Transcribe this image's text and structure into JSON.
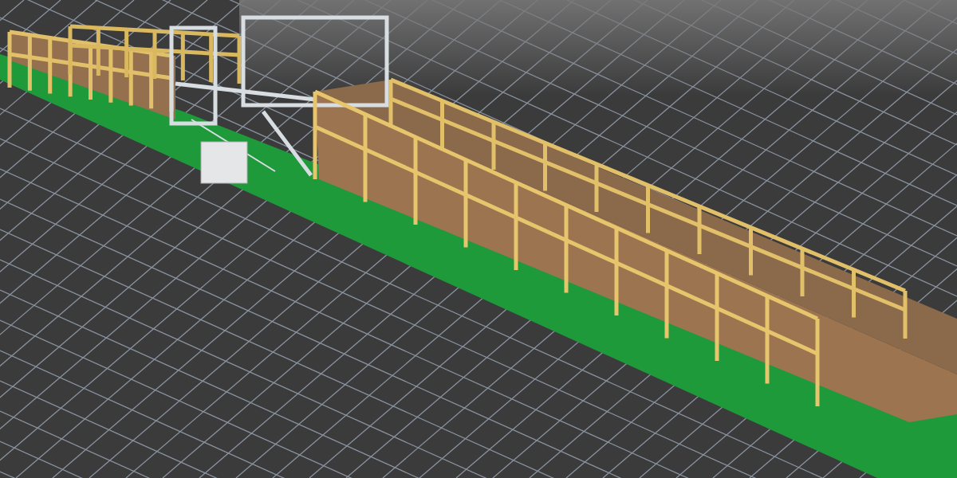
{
  "scene": {
    "kind": "render"
  }
}
